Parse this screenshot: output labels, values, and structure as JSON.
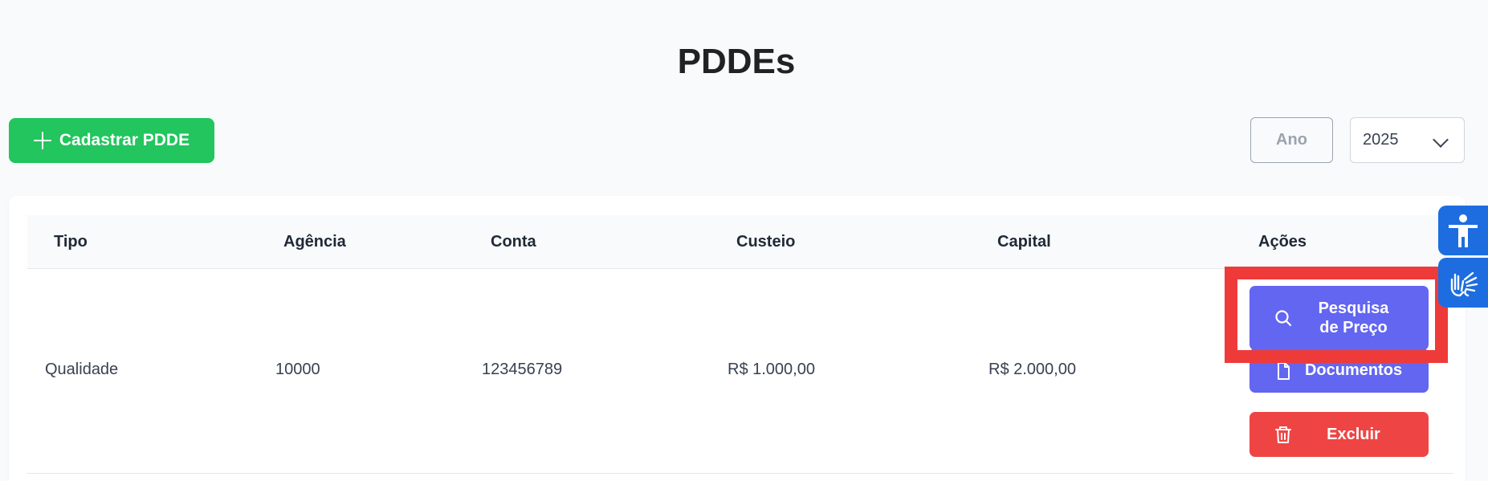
{
  "page": {
    "title": "PDDEs"
  },
  "toolbar": {
    "add_label": "Cadastrar PDDE",
    "year_label": "Ano",
    "year_value": "2025"
  },
  "table": {
    "headers": [
      "Tipo",
      "Agência",
      "Conta",
      "Custeio",
      "Capital",
      "Ações"
    ],
    "rows": [
      {
        "tipo": "Qualidade",
        "agencia": "10000",
        "conta": "123456789",
        "custeio": "R$ 1.000,00",
        "capital": "R$ 2.000,00",
        "actions": {
          "search_price": "Pesquisa de Preço",
          "documents": "Documentos",
          "delete": "Excluir"
        }
      }
    ]
  },
  "colors": {
    "primary_green": "#22c55e",
    "indigo": "#6366f1",
    "danger": "#ef4444",
    "highlight": "#ef3a3a",
    "accessibility_blue": "#1d6de0"
  },
  "icons": {
    "add": "plus-icon",
    "year_dropdown": "chevron-down-icon",
    "search_price": "search-icon",
    "documents": "document-icon",
    "delete": "trash-icon",
    "accessibility": "accessibility-person-icon",
    "sign_language": "sign-language-hands-icon"
  }
}
